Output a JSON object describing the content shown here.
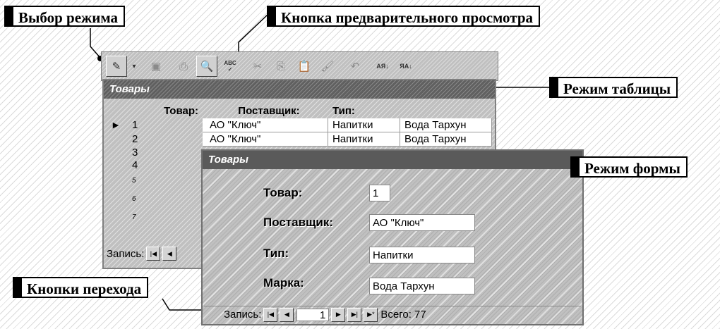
{
  "callouts": {
    "mode_select": "Выбор режима",
    "preview_button": "Кнопка предварительного просмотра",
    "table_mode": "Режим таблицы",
    "form_mode": "Режим формы",
    "nav_buttons": "Кнопки перехода"
  },
  "toolbar": {
    "spell_text": "ABC",
    "sort_asc_text": "АЯ",
    "sort_desc_text": "ЯА"
  },
  "table_window": {
    "title": "Товары",
    "columns": [
      "Товар:",
      "Поставщик:",
      "Тип:"
    ],
    "rows": [
      {
        "product": "1",
        "supplier": "АО \"Ключ\"",
        "type": "Напитки",
        "brand": "Вода Тархун"
      },
      {
        "product": "2",
        "supplier": "АО \"Ключ\"",
        "type": "Напитки",
        "brand": "Вода Тархун"
      },
      {
        "product": "3"
      },
      {
        "product": "4"
      },
      {
        "product": "5"
      },
      {
        "product": "6"
      },
      {
        "product": "7"
      }
    ],
    "nav_label": "Запись:"
  },
  "form_window": {
    "title": "Товары",
    "fields": [
      {
        "label": "Товар:",
        "value": "1"
      },
      {
        "label": "Поставщик:",
        "value": "АО \"Ключ\""
      },
      {
        "label": "Тип:",
        "value": "Напитки"
      },
      {
        "label": "Марка:",
        "value": "Вода Тархун"
      }
    ],
    "nav_label": "Запись:",
    "record": "1",
    "total": "Всего: 77"
  }
}
